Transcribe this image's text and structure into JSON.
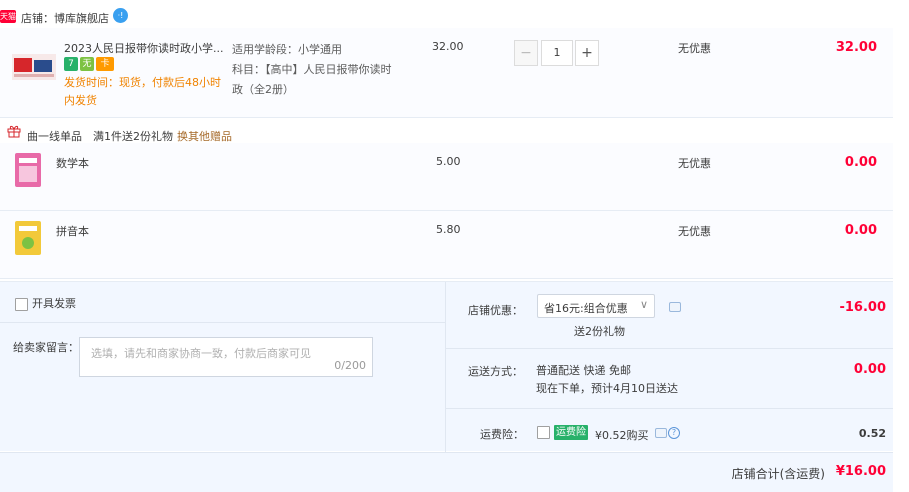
{
  "shop": {
    "badge": "天猫",
    "name": "店铺：博库旗舰店",
    "chat_badge": "·!"
  },
  "item": {
    "title": "2023人民日报带你读时政小学...",
    "service_icons": [
      "7",
      "无",
      "卡"
    ],
    "ship_note": "发货时间：现货，付款后48小时内发货",
    "sku_line1": "适用学龄段：小学通用",
    "sku_line2": "科目：【高中】人民日报带你读时政（全2册）",
    "price": "32.00",
    "qty": "1",
    "minus": "−",
    "plus": "+",
    "discount": "无优惠",
    "total": "32.00"
  },
  "gift_header": {
    "text": "曲一线单品　满1件送2份礼物",
    "link": "换其他赠品"
  },
  "gifts": [
    {
      "name": "数学本",
      "price": "5.00",
      "discount": "无优惠",
      "total": "0.00",
      "thumb_color": "#e86aa8"
    },
    {
      "name": "拼音本",
      "price": "5.80",
      "discount": "无优惠",
      "total": "0.00",
      "thumb_color": "#f2c93a"
    }
  ],
  "invoice": {
    "label": "开具发票"
  },
  "message": {
    "label": "给卖家留言：",
    "placeholder": "选填，请先和商家协商一致，付款后商家可见",
    "count": "0/200"
  },
  "shop_discount": {
    "label": "店铺优惠：",
    "selected": "省16元:组合优惠",
    "note": "送2份礼物",
    "amount": "-16.00"
  },
  "shipping": {
    "label": "运送方式：",
    "line1": "普通配送 快递 免邮",
    "line2": "现在下单，预计4月10日送达",
    "amount": "0.00"
  },
  "insurance": {
    "label": "运费险：",
    "badge": "运费险",
    "price": "¥0.52购买",
    "amount": "0.52"
  },
  "shop_total": {
    "label": "店铺合计(含运费)",
    "amount": "¥16.00"
  },
  "colors": {
    "accent_red": "#ff0036",
    "ship_orange": "#f08300",
    "insurance_green": "#28b16a",
    "panel_bg": "#f2f7ff"
  }
}
